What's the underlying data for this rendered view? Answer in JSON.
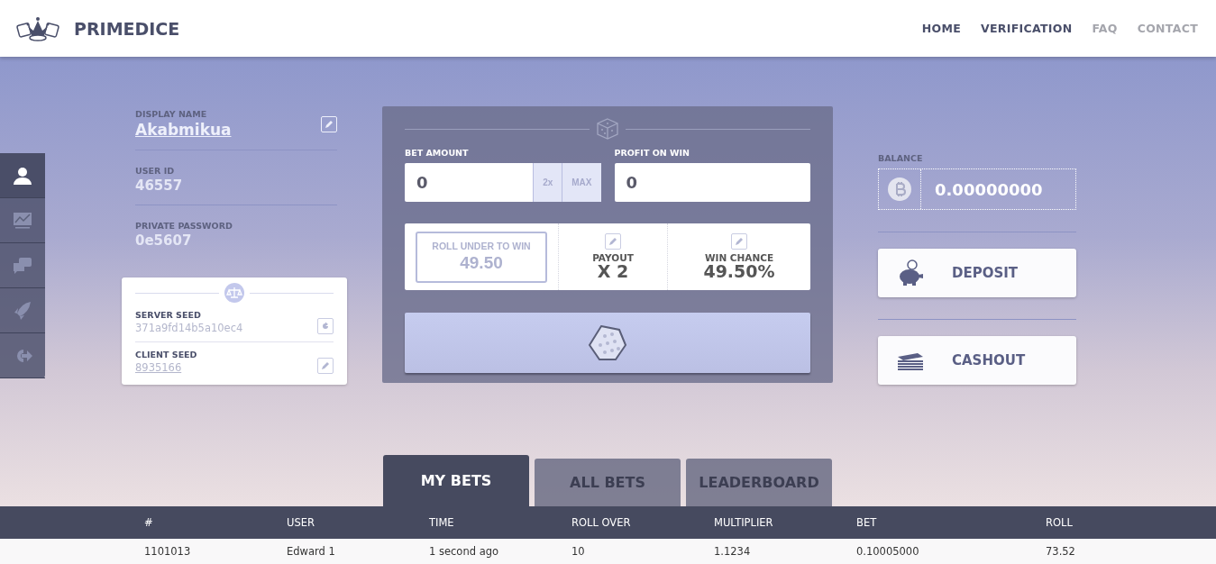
{
  "brand": {
    "name": "PRIMEDICE"
  },
  "nav": [
    {
      "label": "HOME",
      "dimmed": false
    },
    {
      "label": "VERIFICATION",
      "dimmed": false
    },
    {
      "label": "FAQ",
      "dimmed": true
    },
    {
      "label": "CONTACT",
      "dimmed": true
    }
  ],
  "side_rail": [
    {
      "kind": "user",
      "selected": true
    },
    {
      "kind": "chart",
      "selected": false
    },
    {
      "kind": "chat",
      "selected": false
    },
    {
      "kind": "rocket",
      "selected": false
    },
    {
      "kind": "logout",
      "selected": false
    }
  ],
  "profile": {
    "display_name_label": "DISPLAY NAME",
    "display_name": "Akabmikua",
    "user_id_label": "USER ID",
    "user_id": "46557",
    "password_label": "PRIVATE PASSWORD",
    "password": "0e5607"
  },
  "seeds": {
    "server_label": "SERVER SEED",
    "server": "371a9fd14b5a10ec4",
    "client_label": "CLIENT SEED",
    "client": "8935166"
  },
  "bet": {
    "bet_amount_label": "BET AMOUNT",
    "bet_amount": "0",
    "double": "2x",
    "max": "MAX",
    "profit_label": "PROFIT ON WIN",
    "profit": "0",
    "roll_label": "ROLL UNDER TO WIN",
    "roll": "49.50",
    "payout_label": "PAYOUT",
    "payout": "X 2",
    "chance_label": "WIN CHANCE",
    "chance": "49.50%"
  },
  "wallet": {
    "balance_label": "BALANCE",
    "balance": "0.00000000",
    "deposit": "DEPOSIT",
    "cashout": "CASHOUT"
  },
  "tabs": [
    {
      "label": "MY BETS",
      "selected": true
    },
    {
      "label": "ALL BETS",
      "selected": false
    },
    {
      "label": "LEADERBOARD",
      "selected": false
    }
  ],
  "table": {
    "columns": [
      "#",
      "USER",
      "TIME",
      "ROLL OVER",
      "MULTIPLIER",
      "BET",
      "ROLL"
    ],
    "rows": [
      [
        "1101013",
        "Edward 1",
        "1 second ago",
        "10",
        "1.1234",
        "0.10005000",
        "73.52"
      ]
    ]
  }
}
